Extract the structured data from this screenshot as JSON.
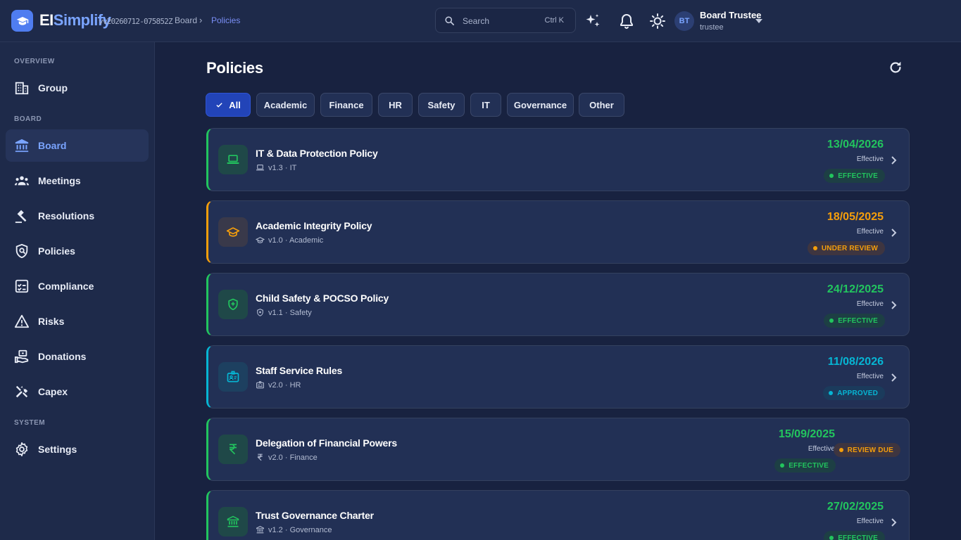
{
  "app": {
    "brand_part1": "EI",
    "brand_part2": "Simplify",
    "version": "vv20260712-075852Z"
  },
  "breadcrumb": {
    "parent": "Board",
    "separator": "›",
    "current": "Policies"
  },
  "search": {
    "placeholder": "Search",
    "shortcut": "Ctrl K"
  },
  "user": {
    "initials": "BT",
    "name": "Board Trustee",
    "role": "trustee"
  },
  "sidebar": {
    "sections": [
      {
        "label": "OVERVIEW",
        "items": [
          {
            "label": "Group",
            "icon": "building-icon"
          }
        ]
      },
      {
        "label": "BOARD",
        "items": [
          {
            "label": "Board",
            "icon": "bank-icon",
            "active": true
          },
          {
            "label": "Meetings",
            "icon": "people-icon"
          },
          {
            "label": "Resolutions",
            "icon": "gavel-icon"
          },
          {
            "label": "Policies",
            "icon": "policy-shield-icon"
          },
          {
            "label": "Compliance",
            "icon": "checklist-icon"
          },
          {
            "label": "Risks",
            "icon": "warning-icon"
          },
          {
            "label": "Donations",
            "icon": "donation-icon"
          },
          {
            "label": "Capex",
            "icon": "tools-icon"
          }
        ]
      },
      {
        "label": "SYSTEM",
        "items": [
          {
            "label": "Settings",
            "icon": "gear-icon"
          }
        ]
      }
    ]
  },
  "page": {
    "title": "Policies"
  },
  "filters": [
    "All",
    "Academic",
    "Finance",
    "HR",
    "Safety",
    "IT",
    "Governance",
    "Other"
  ],
  "active_filter": "All",
  "colors": {
    "green": "#22c55e",
    "orange": "#f59e0b",
    "cyan": "#06b6d4",
    "accent": "#2244b8"
  },
  "policies": [
    {
      "title": "IT & Data Protection Policy",
      "meta": "v1.3 · IT",
      "icon": "laptop-icon",
      "date": "13/04/2026",
      "date_label": "Effective",
      "status": "EFFECTIVE",
      "color": "green"
    },
    {
      "title": "Academic Integrity Policy",
      "meta": "v1.0 · Academic",
      "icon": "graduation-cap-icon",
      "date": "18/05/2025",
      "date_label": "Effective",
      "status": "UNDER REVIEW",
      "color": "orange"
    },
    {
      "title": "Child Safety & POCSO Policy",
      "meta": "v1.1 · Safety",
      "icon": "shield-plus-icon",
      "date": "24/12/2025",
      "date_label": "Effective",
      "status": "EFFECTIVE",
      "color": "green"
    },
    {
      "title": "Staff Service Rules",
      "meta": "v2.0 · HR",
      "icon": "id-badge-icon",
      "date": "11/08/2026",
      "date_label": "Effective",
      "status": "APPROVED",
      "color": "cyan"
    },
    {
      "title": "Delegation of Financial Powers",
      "meta": "v2.0 · Finance",
      "icon": "rupee-icon",
      "date": "15/09/2025",
      "date_label": "Effective",
      "status": "EFFECTIVE",
      "extra_status": "REVIEW DUE",
      "color": "green"
    },
    {
      "title": "Trust Governance Charter",
      "meta": "v1.2 · Governance",
      "icon": "bank-icon",
      "date": "27/02/2025",
      "date_label": "Effective",
      "status": "EFFECTIVE",
      "color": "green"
    }
  ]
}
